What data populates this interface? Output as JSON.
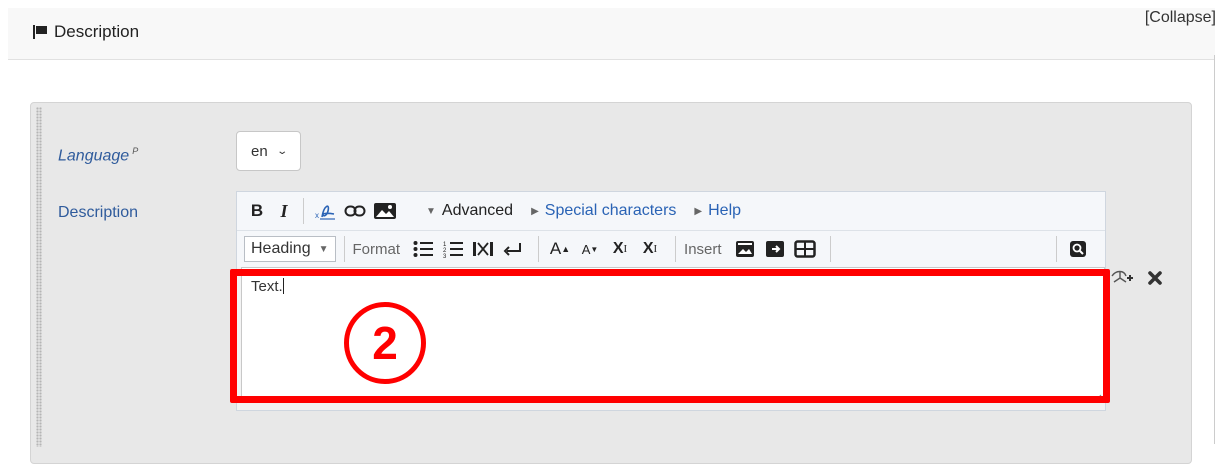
{
  "section": {
    "title": "Description",
    "collapse_label": "[Collapse]"
  },
  "form": {
    "language_label": "Language",
    "language_marker": "P",
    "language_value": "en",
    "description_label": "Description"
  },
  "editor": {
    "toolbar1": {
      "bold": "B",
      "italic": "I",
      "advanced": "Advanced",
      "special_characters": "Special characters",
      "help": "Help"
    },
    "toolbar2": {
      "heading_value": "Heading",
      "format_label": "Format",
      "insert_label": "Insert",
      "font_larger": "A",
      "font_smaller": "A",
      "superscript_base": "X",
      "superscript_mark": "I",
      "subscript_base": "X",
      "subscript_mark": "I"
    },
    "content": "Text."
  },
  "annotation": {
    "step_number": "2",
    "highlight_color": "#ff0000"
  },
  "colors": {
    "label_blue": "#2f5b9c",
    "link_blue": "#2a63b5",
    "panel_bg": "#e8e8e8"
  },
  "icons": [
    "flag-icon",
    "select-chevron-icon",
    "signature-icon",
    "link-icon",
    "image-icon",
    "list-bullet-icon",
    "list-numbered-icon",
    "clear-format-icon",
    "line-break-icon",
    "insert-image-icon",
    "insert-media-icon",
    "insert-table-icon",
    "preview-icon",
    "add-row-icon",
    "remove-icon"
  ]
}
